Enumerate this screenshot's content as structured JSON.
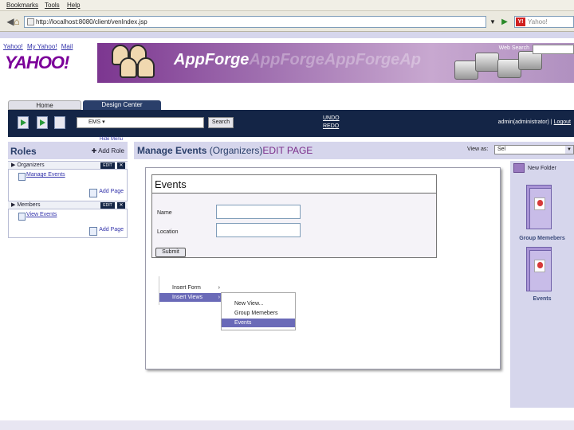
{
  "browser": {
    "menu": [
      "Bookmarks",
      "Tools",
      "Help"
    ],
    "url": "http://localhost:8080/client/venIndex.jsp",
    "search_placeholder": "Yahoo!"
  },
  "yahoo": {
    "links": [
      "Yahoo!",
      "My Yahoo!",
      "Mail"
    ],
    "logo": "YAHOO!"
  },
  "banner": {
    "title": "AppForge",
    "ghost_title": "AppForgeAppForgeAp",
    "web_search_label": "Web Search"
  },
  "tabs": {
    "home": "Home",
    "design": "Design Center"
  },
  "toolbar": {
    "app_select": "EMS",
    "search_button": "Search",
    "undo": "UNDO",
    "redo": "REDO",
    "user": "admin(administrator)",
    "logout": "Logout"
  },
  "sidebar": {
    "hide_menu": "Hide Menu",
    "title": "Roles",
    "add_role": "Add Role",
    "groups": [
      {
        "name": "Organizers",
        "edit": "EDIT",
        "pages": [
          "Manage Events"
        ],
        "add_page": "Add Page"
      },
      {
        "name": "Members",
        "edit": "EDIT",
        "pages": [
          "View Events"
        ],
        "add_page": "Add Page"
      }
    ]
  },
  "main": {
    "title": "Manage Events",
    "role": "(Organizers)",
    "edit": "EDIT PAGE",
    "view_as_label": "View as:",
    "view_as_value": "Sel"
  },
  "form": {
    "title": "Events",
    "name_label": "Name",
    "location_label": "Location",
    "submit": "Submit"
  },
  "context_menu": {
    "items": [
      "Insert Form",
      "Insert Views"
    ],
    "submenu": [
      "New View...",
      "Group Memebers",
      "Events"
    ]
  },
  "right_panel": {
    "new_folder": "New Folder",
    "folders": [
      "Group Memebers",
      "Events"
    ]
  }
}
